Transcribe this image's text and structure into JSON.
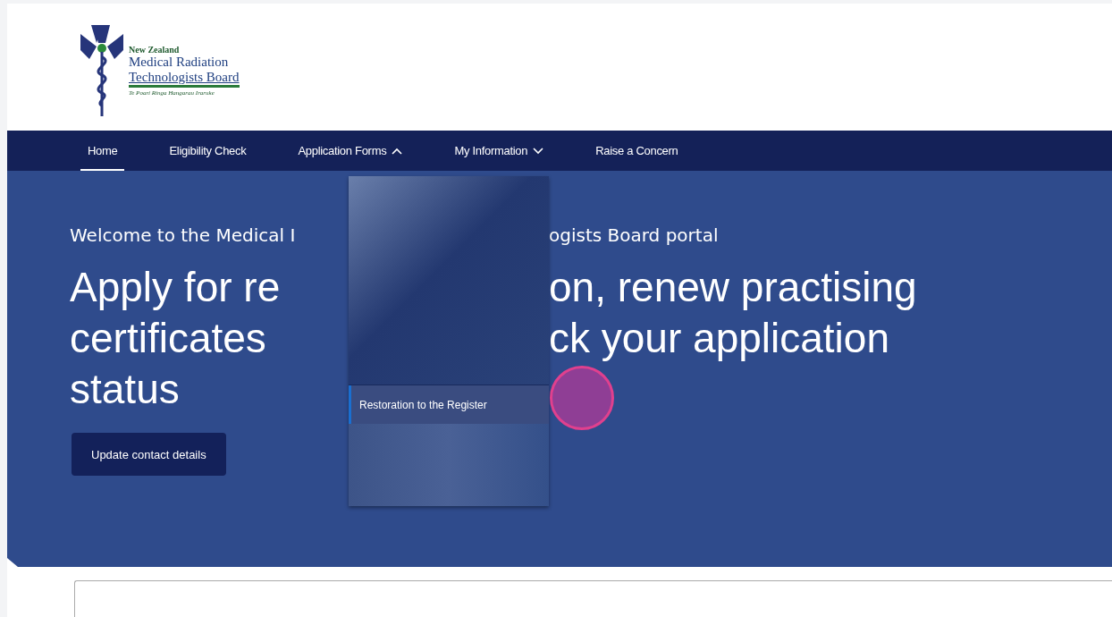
{
  "logo": {
    "line_1": "New Zealand",
    "line_2": "Medical Radiation",
    "line_3": "Technologists Board",
    "tagline": "Te Poari Ringa Hangarau Iraruke"
  },
  "nav": [
    {
      "label": "Home",
      "selected": true
    },
    {
      "label": "Eligibility Check",
      "selected": false
    },
    {
      "label": "Application Forms",
      "selected": false,
      "expanded": true
    },
    {
      "label": "My Information",
      "selected": false,
      "expanded": false
    },
    {
      "label": "Raise a Concern",
      "selected": false
    }
  ],
  "dropdown": {
    "items": [
      {
        "label": "Restoration to the Register",
        "selected": true
      }
    ]
  },
  "hero": {
    "subtitle": [
      "Welcome to the Medical I",
      "ogists Board portal"
    ],
    "heading_lines": [
      [
        "Apply for re",
        "on, renew practising"
      ],
      [
        "certificates",
        "ck your application"
      ],
      [
        "status"
      ]
    ],
    "button": "Update contact details"
  }
}
